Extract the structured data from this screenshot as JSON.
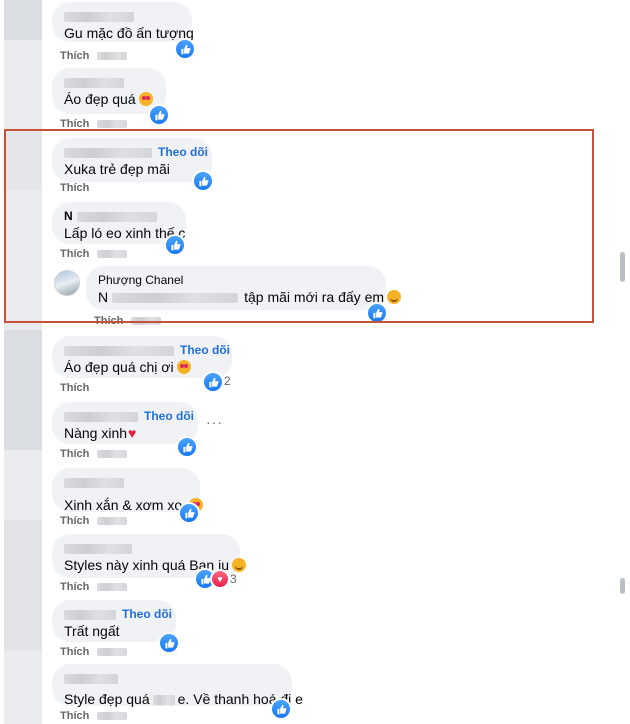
{
  "comments": [
    {
      "id": "c1",
      "text": "Gu mặc đồ ấn tượng",
      "follow": "",
      "action": "Thích",
      "emoji": "",
      "reactions": []
    },
    {
      "id": "c2",
      "text": "Áo đẹp quá",
      "follow": "",
      "action": "Thích",
      "emoji": "love",
      "reactions": []
    },
    {
      "id": "c3",
      "name": "Lê Quang Hoà",
      "text": "Xuka trẻ đẹp mãi",
      "follow": "Theo dõi",
      "action": "Thích",
      "emoji": "",
      "reactions": []
    },
    {
      "id": "c4",
      "name": "N",
      "text": "Lấp ló eo xinh thế c",
      "follow": "",
      "action": "Thích",
      "emoji": "",
      "reactions": []
    },
    {
      "id": "c5",
      "name": "Phượng Chanel",
      "text_prefix": "N",
      "text": "tập mãi mới ra đấy em",
      "follow": "",
      "action": "Thích",
      "emoji": "smile",
      "reactions": []
    },
    {
      "id": "c6",
      "text": "Áo đẹp quá chị ơi",
      "follow": "Theo dõi",
      "action": "Thích",
      "emoji": "love",
      "reactions": [
        {
          "type": "like",
          "count": "2"
        }
      ]
    },
    {
      "id": "c7",
      "text": "Nàng xinh",
      "follow": "Theo dõi",
      "action": "Thích",
      "emoji": "heart",
      "reactions": []
    },
    {
      "id": "c8",
      "text": "Xinh xắn & xơm xo.",
      "follow": "",
      "action": "Thích",
      "emoji": "love",
      "reactions": []
    },
    {
      "id": "c9",
      "text": "Styles này xinh quá Bạn iu",
      "follow": "",
      "action": "Thích",
      "emoji": "smile",
      "reactions": [
        {
          "type": "like-love",
          "count": "3"
        }
      ]
    },
    {
      "id": "c10",
      "text": "Trất ngất",
      "follow": "Theo dõi",
      "action": "Thích",
      "emoji": "",
      "reactions": []
    },
    {
      "id": "c11",
      "text": "Style đẹp quá",
      "text_suffix": "e. Về thanh hoá đi e",
      "follow": "",
      "action": "Thích",
      "emoji": "",
      "reactions": []
    }
  ],
  "more_options": "···",
  "colors": {
    "follow": "#216fdb",
    "like": "#1877f2",
    "love": "#e61e4d",
    "highlight": "#c5523a",
    "bubble": "#f0f2f5"
  }
}
